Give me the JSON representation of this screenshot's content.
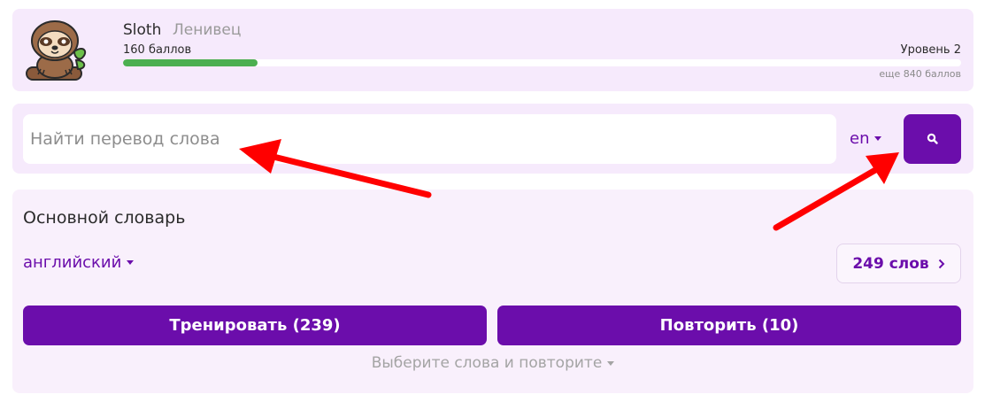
{
  "profile": {
    "name": "Sloth",
    "name_ru": "Ленивец",
    "points": "160 баллов",
    "level": "Уровень 2",
    "remaining": "еще 840 баллов",
    "progress_fraction": 0.16
  },
  "search": {
    "placeholder": "Найти перевод слова",
    "language": "en",
    "button_icon": "search-icon"
  },
  "dictionary": {
    "title": "Основной словарь",
    "language": "английский",
    "words_count": "249 слов",
    "train_label": "Тренировать (239)",
    "repeat_label": "Повторить (10)",
    "select_hint": "Выберите слова и повторите"
  },
  "colors": {
    "accent": "#6b0dab",
    "card_bg": "#f6eafc",
    "progress": "#4caf50",
    "annotation_arrow": "#ff0000"
  }
}
